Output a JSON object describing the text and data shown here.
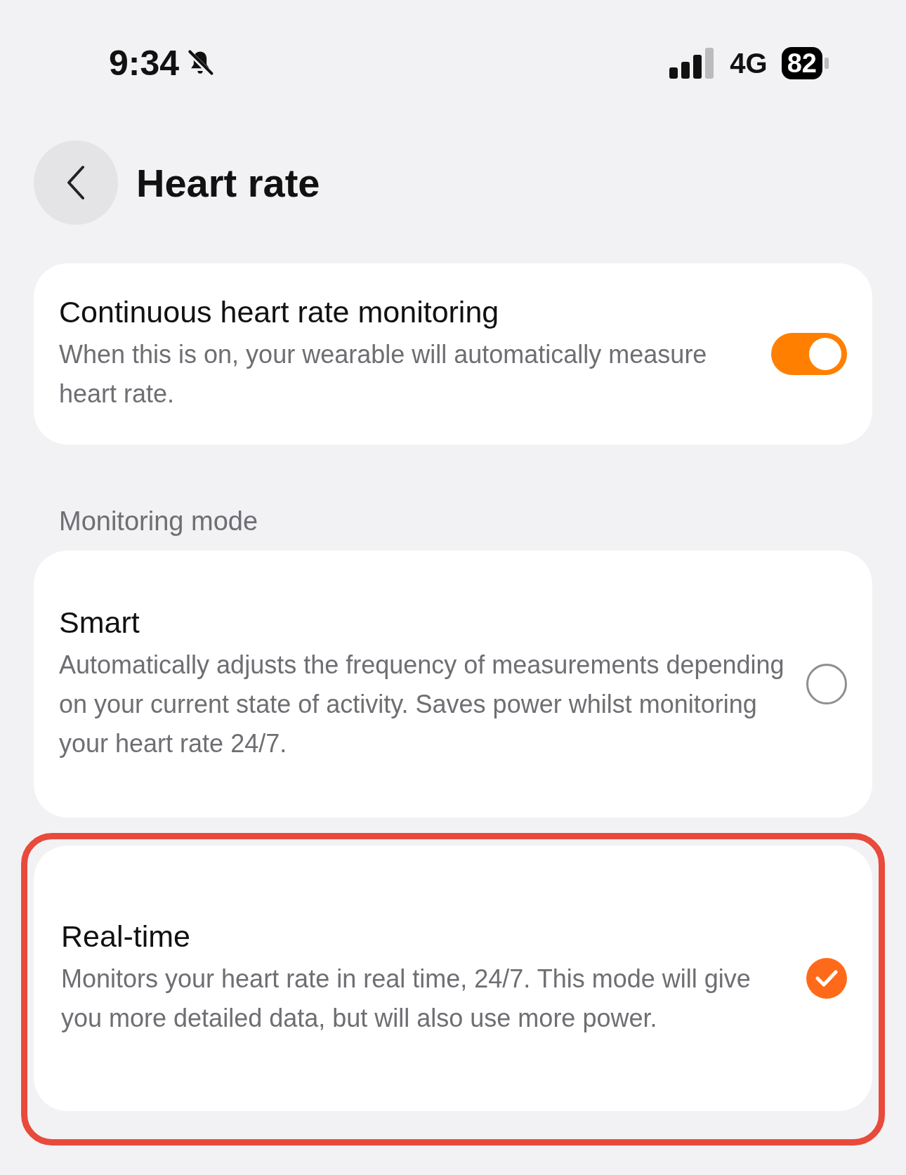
{
  "status_bar": {
    "time": "9:34",
    "network": "4G",
    "battery": "82"
  },
  "header": {
    "title": "Heart rate"
  },
  "continuous": {
    "title": "Continuous heart rate monitoring",
    "description": "When this is on, your wearable will automatically measure heart rate.",
    "on": true
  },
  "section_label": "Monitoring mode",
  "modes": [
    {
      "title": "Smart",
      "description": "Automatically adjusts the frequency of measurements depending on your current state of activity. Saves power whilst monitoring your heart rate 24/7.",
      "selected": false,
      "highlighted": false
    },
    {
      "title": "Real-time",
      "description": "Monitors your heart rate in real time, 24/7. This mode will give you more detailed data, but will also use more power.",
      "selected": true,
      "highlighted": true
    }
  ]
}
